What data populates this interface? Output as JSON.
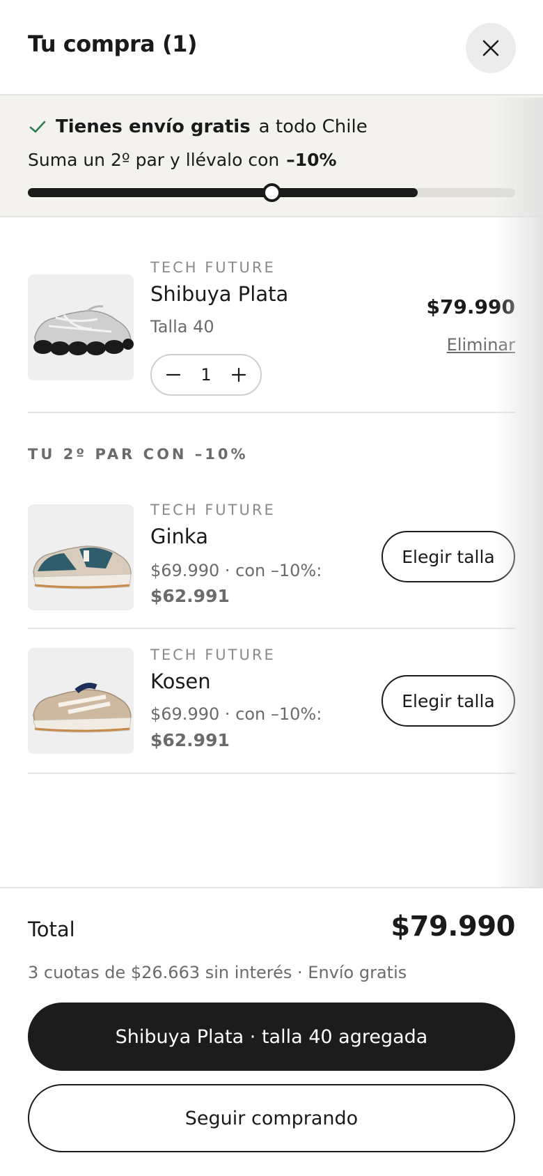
{
  "header": {
    "title": "Tu compra (1)",
    "close_icon": "close-icon"
  },
  "promo": {
    "free_shipping_strong": "Tienes envío gratis",
    "free_shipping_rest": "a todo Chile",
    "second_pair_text": "Suma un 2º par y llévalo con",
    "second_pair_discount": "–10%",
    "progress_fill": 0.8,
    "progress_knob": 0.5
  },
  "cart_item": {
    "brand": "TECH FUTURE",
    "name": "Shibuya Plata",
    "size": "Talla 40",
    "price": "$79.990",
    "remove_label": "Eliminar",
    "quantity": "1"
  },
  "recommendations": {
    "title": "TU 2º PAR CON –10%",
    "items": [
      {
        "brand": "TECH FUTURE",
        "name": "Ginka",
        "price_line": "$69.990 · con –10%:",
        "discounted_price": "$62.991",
        "button_label": "Elegir talla"
      },
      {
        "brand": "TECH FUTURE",
        "name": "Kosen",
        "price_line": "$69.990 · con –10%:",
        "discounted_price": "$62.991",
        "button_label": "Elegir talla"
      }
    ]
  },
  "footer": {
    "total_label": "Total",
    "total_value": "$79.990",
    "installments": "3 cuotas de $26.663 sin interés · Envío gratis",
    "primary_button": "Shibuya Plata · talla 40 agregada",
    "secondary_button": "Seguir comprando"
  },
  "colors": {
    "accent_check": "#2e7d4f",
    "dark": "#1a1a1a",
    "banner_bg": "#f3f2ee"
  }
}
